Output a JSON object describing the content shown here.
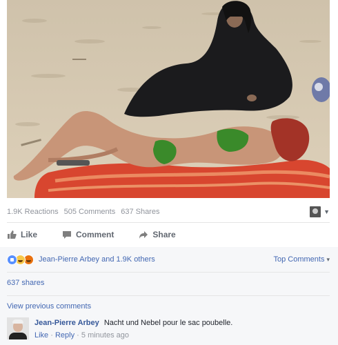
{
  "photo": {
    "description_icon": "beach-photo"
  },
  "stats": {
    "reactions": "1.9K Reactions",
    "comments": "505 Comments",
    "shares": "637 Shares"
  },
  "actions": {
    "like": "Like",
    "comment": "Comment",
    "share": "Share"
  },
  "reactions_summary": {
    "text": "Jean-Pierre Arbey and 1.9K others",
    "sort": "Top Comments"
  },
  "shares_link": "637 shares",
  "view_previous": "View previous comments",
  "comment": {
    "author": "Jean-Pierre Arbey",
    "text": "Nacht und Nebel pour le sac poubelle.",
    "like": "Like",
    "reply": "Reply",
    "sep": "·",
    "time": "5 minutes ago"
  },
  "colors": {
    "link": "#4267b2",
    "muted": "#90949c",
    "bottom_bg": "#f6f7f9"
  }
}
